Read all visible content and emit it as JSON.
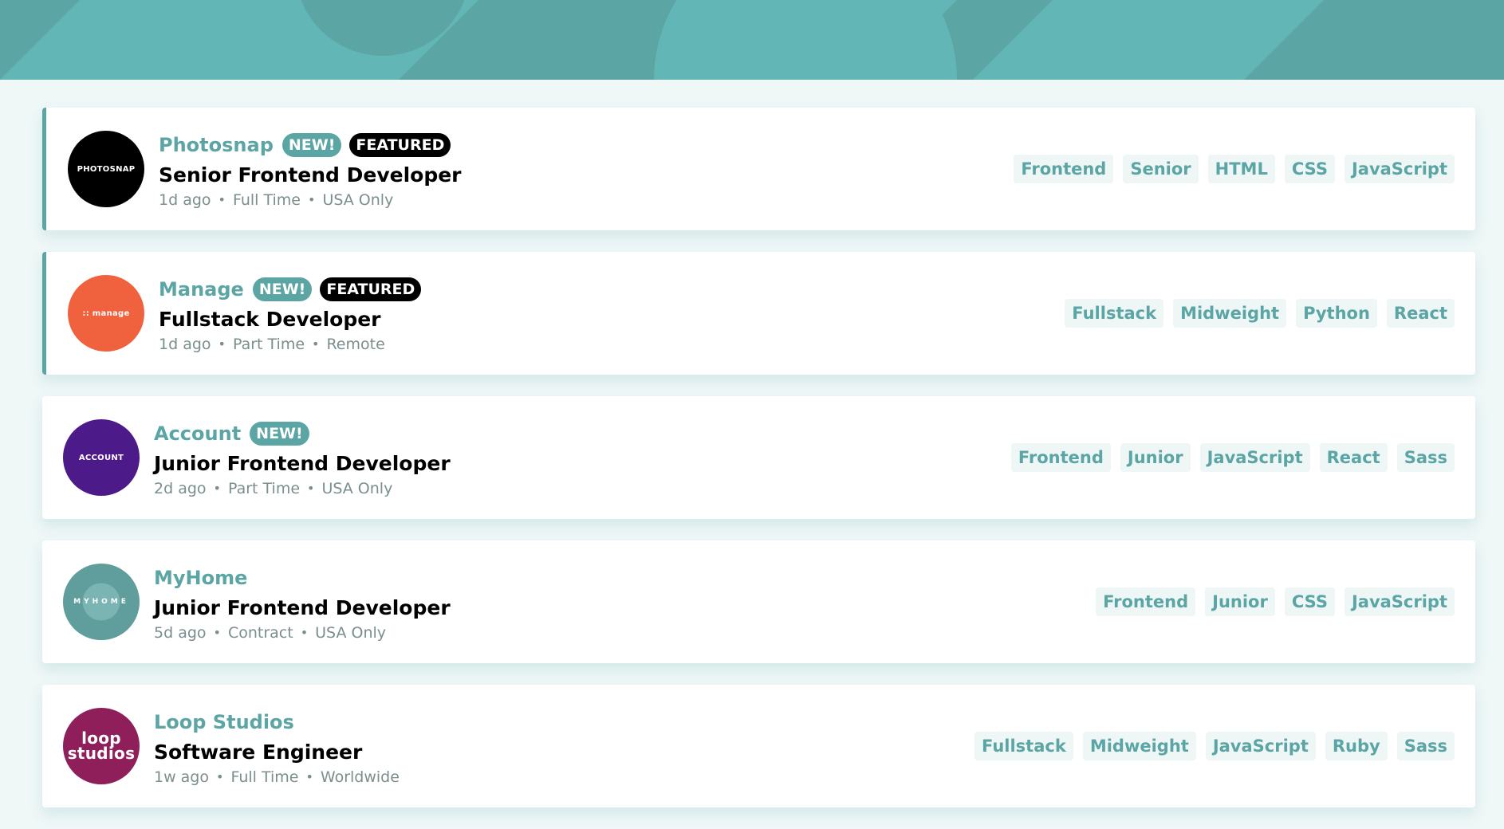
{
  "colors": {
    "primary": "#5ca5a5",
    "background": "#eff7f7",
    "tag_background": "#eef6f6",
    "featured_badge": "#000000"
  },
  "jobs": [
    {
      "company": "Photosnap",
      "logo_text": "PHOTOSNAP",
      "is_new": true,
      "is_featured": true,
      "new_label": "NEW!",
      "featured_label": "FEATURED",
      "position": "Senior Frontend Developer",
      "posted_at": "1d ago",
      "contract": "Full Time",
      "location": "USA Only",
      "tags": [
        "Frontend",
        "Senior",
        "HTML",
        "CSS",
        "JavaScript"
      ]
    },
    {
      "company": "Manage",
      "logo_text": ":: manage",
      "is_new": true,
      "is_featured": true,
      "new_label": "NEW!",
      "featured_label": "FEATURED",
      "position": "Fullstack Developer",
      "posted_at": "1d ago",
      "contract": "Part Time",
      "location": "Remote",
      "tags": [
        "Fullstack",
        "Midweight",
        "Python",
        "React"
      ]
    },
    {
      "company": "Account",
      "logo_text": "ACCOUNT",
      "is_new": true,
      "is_featured": false,
      "new_label": "NEW!",
      "position": "Junior Frontend Developer",
      "posted_at": "2d ago",
      "contract": "Part Time",
      "location": "USA Only",
      "tags": [
        "Frontend",
        "Junior",
        "JavaScript",
        "React",
        "Sass"
      ]
    },
    {
      "company": "MyHome",
      "logo_text": "MYHOME",
      "is_new": false,
      "is_featured": false,
      "position": "Junior Frontend Developer",
      "posted_at": "5d ago",
      "contract": "Contract",
      "location": "USA Only",
      "tags": [
        "Frontend",
        "Junior",
        "CSS",
        "JavaScript"
      ]
    },
    {
      "company": "Loop Studios",
      "logo_text": "loop studios",
      "is_new": false,
      "is_featured": false,
      "position": "Software Engineer",
      "posted_at": "1w ago",
      "contract": "Full Time",
      "location": "Worldwide",
      "tags": [
        "Fullstack",
        "Midweight",
        "JavaScript",
        "Ruby",
        "Sass"
      ]
    }
  ]
}
